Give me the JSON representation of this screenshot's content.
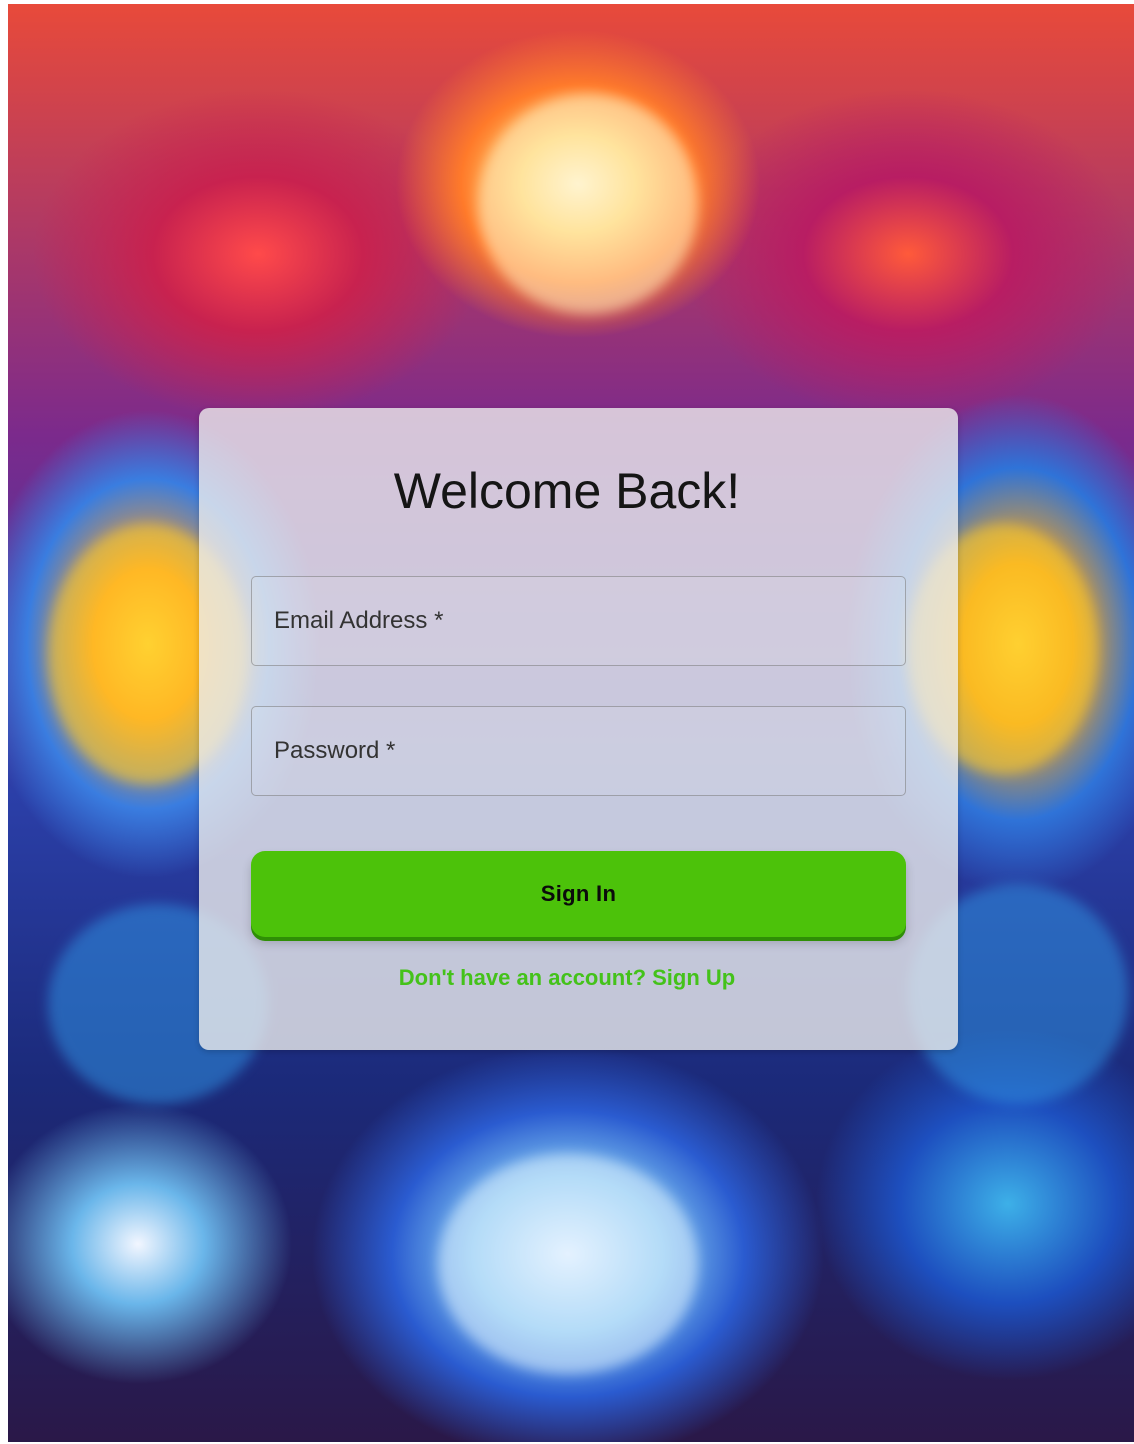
{
  "theme": {
    "accent_green": "#4cc20a",
    "link_green": "#44c21a",
    "card_bg": "#ececec"
  },
  "form": {
    "title": "Welcome Back!",
    "email_placeholder": "Email Address *",
    "password_placeholder": "Password *",
    "submit_label": "Sign In",
    "signup_link": "Don't have an account? Sign Up"
  }
}
